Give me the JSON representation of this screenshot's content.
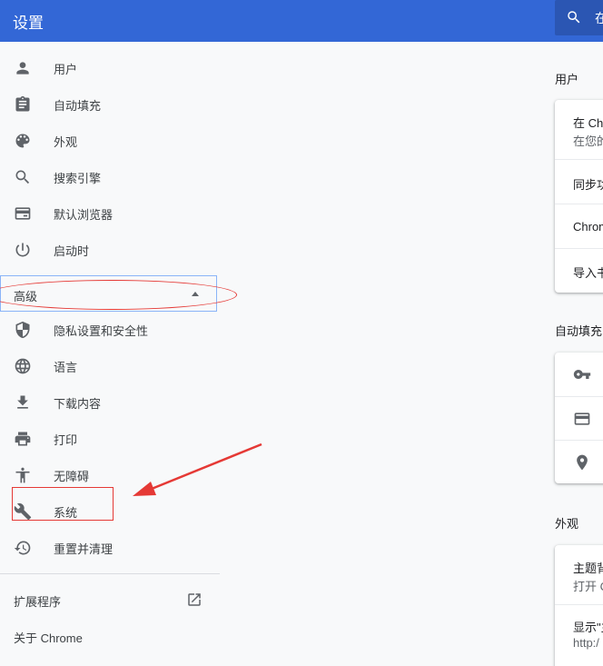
{
  "header": {
    "title": "设置",
    "search_text": "在"
  },
  "sidebar": {
    "items": [
      {
        "label": "用户",
        "icon": "person-icon"
      },
      {
        "label": "自动填充",
        "icon": "clipboard-icon"
      },
      {
        "label": "外观",
        "icon": "palette-icon"
      },
      {
        "label": "搜索引擎",
        "icon": "search-icon"
      },
      {
        "label": "默认浏览器",
        "icon": "browser-window-icon"
      },
      {
        "label": "启动时",
        "icon": "power-icon"
      }
    ],
    "advanced_label": "高级",
    "advanced_items": [
      {
        "label": "隐私设置和安全性",
        "icon": "shield-icon"
      },
      {
        "label": "语言",
        "icon": "globe-icon"
      },
      {
        "label": "下载内容",
        "icon": "download-icon"
      },
      {
        "label": "打印",
        "icon": "printer-icon"
      },
      {
        "label": "无障碍",
        "icon": "accessibility-icon"
      },
      {
        "label": "系统",
        "icon": "wrench-icon"
      },
      {
        "label": "重置并清理",
        "icon": "restore-icon"
      }
    ],
    "extensions_label": "扩展程序",
    "about_label": "关于 Chrome"
  },
  "main": {
    "people": {
      "title": "用户",
      "rows": [
        {
          "line1": "在 Chr",
          "line2": "在您的"
        },
        {
          "line1": "同步功"
        },
        {
          "line1": "Chrom"
        },
        {
          "line1": "导入书"
        }
      ]
    },
    "autofill": {
      "title": "自动填充",
      "rows": [
        {
          "icon": "key-icon"
        },
        {
          "icon": "credit-card-icon"
        },
        {
          "icon": "location-pin-icon"
        }
      ]
    },
    "appearance": {
      "title": "外观",
      "rows": [
        {
          "line1": "主题背",
          "line2": "打开 C"
        },
        {
          "line1": "显示\"主",
          "line2": "http:/"
        }
      ]
    }
  },
  "annotations": {
    "highlight_color": "#e53935",
    "accent": "#3367d6"
  }
}
